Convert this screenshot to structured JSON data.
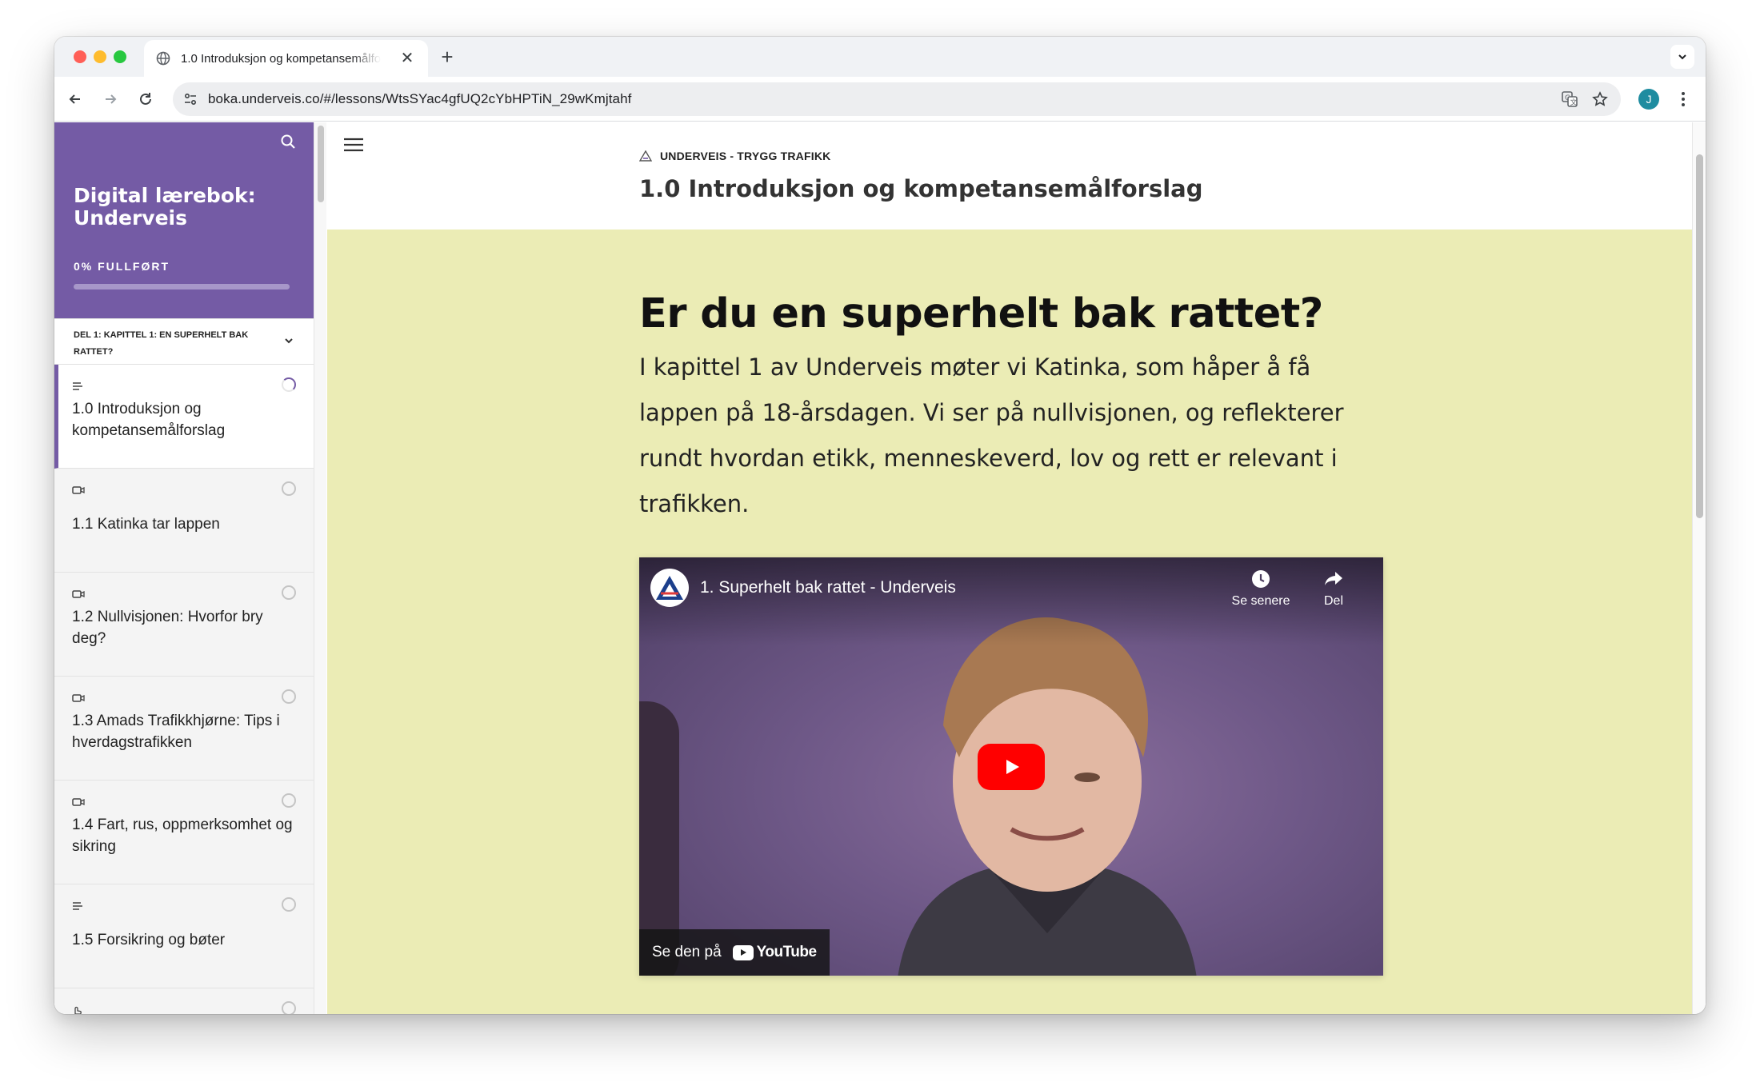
{
  "browser": {
    "tab": {
      "title": "1.0 Introduksjon og kompetansemålforslag",
      "favicon": "globe-icon"
    },
    "url": {
      "host": "boka.underveis.co",
      "path": "/#/lessons/WtsSYac4gfUQ2cYbHPTiN_29wKmjtahf"
    },
    "profile_initial": "J"
  },
  "sidebar": {
    "title": "Digital lærebok: Underveis",
    "progress_label": "0% FULLFØRT",
    "progress_fraction": 0,
    "chapter": "DEL 1: KAPITTEL 1: EN SUPERHELT BAK RATTET?",
    "lessons": [
      {
        "label": "1.0 Introduksjon og kompetansemålforslag",
        "type": "text-icon",
        "active": true
      },
      {
        "label": "1.1 Katinka tar lappen",
        "type": "video-icon"
      },
      {
        "label": "1.2 Nullvisjonen: Hvorfor bry deg?",
        "type": "video-icon"
      },
      {
        "label": "1.3 Amads Trafikkhjørne: Tips i hverdagstrafikken",
        "type": "video-icon"
      },
      {
        "label": "1.4 Fart, rus, oppmerksomhet og sikring",
        "type": "video-icon"
      },
      {
        "label": "1.5 Forsikring og bøter",
        "type": "text-icon"
      }
    ]
  },
  "main": {
    "course_name": "UNDERVEIS - TRYGG TRAFIKK",
    "lesson_title": "1.0 Introduksjon og kompetansemålforslag",
    "headline": "Er du en superhelt bak rattet?",
    "intro": "I kapittel 1 av Underveis møter vi Katinka, som håper å få lappen på 18-årsdagen. Vi ser på nullvisjonen, og reflekterer rundt hvordan etikk, menneskeverd, lov og rett er relevant i trafikken.",
    "video": {
      "title": "1. Superhelt bak rattet - Underveis",
      "watch_later": "Se senere",
      "share": "Del",
      "watch_on": "Se den på",
      "platform": "YouTube"
    }
  },
  "colors": {
    "brand": "#745ba5",
    "body_bg": "#ebecb5",
    "play": "#ff0000"
  }
}
